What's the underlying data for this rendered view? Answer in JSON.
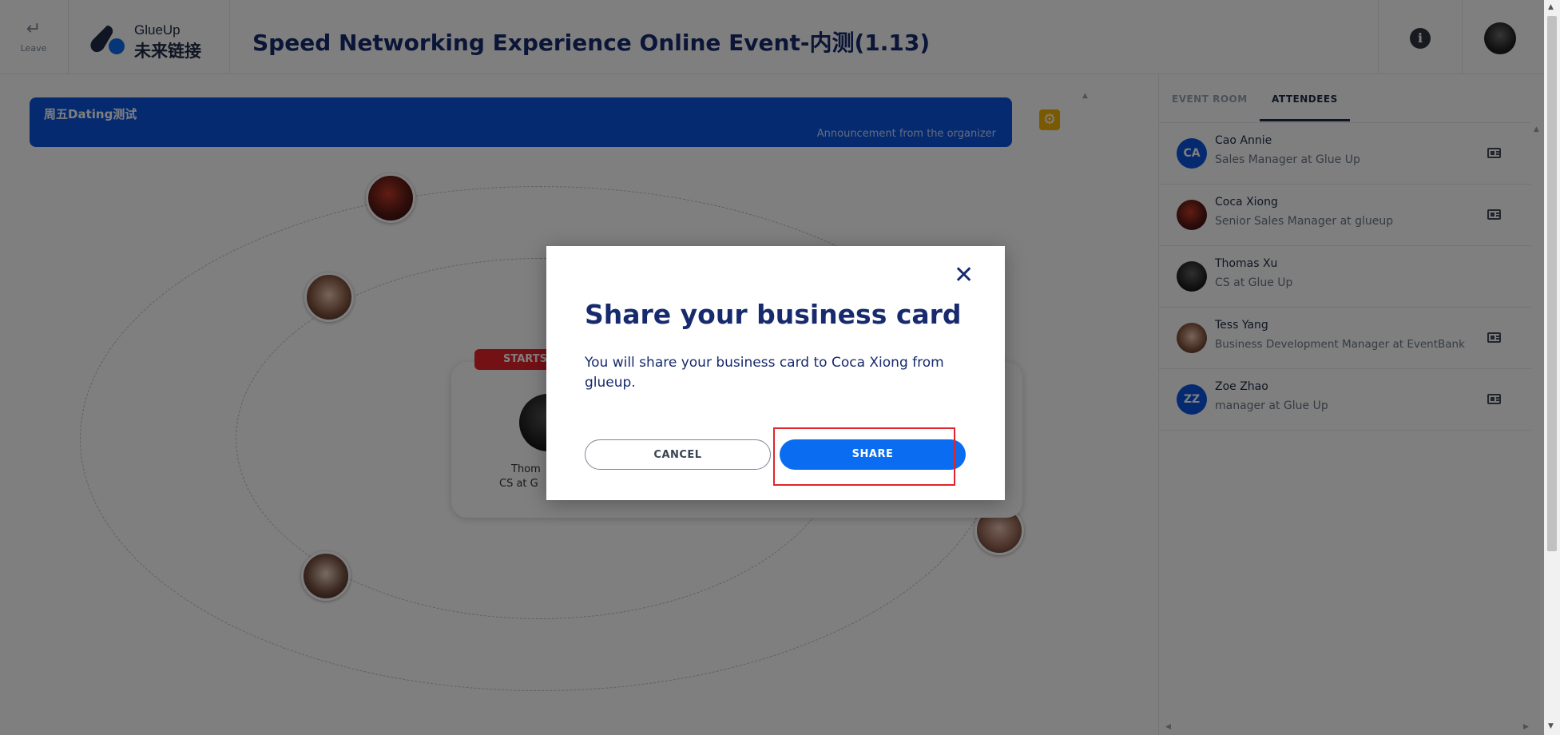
{
  "header": {
    "leave_label": "Leave",
    "brand_en": "GlueUp",
    "brand_cn": "未来链接",
    "event_title": "Speed Networking Experience Online Event-内测(1.13)",
    "info_icon": "info-icon"
  },
  "announcement": {
    "title": "周五Dating测试",
    "source": "Announcement from the organizer"
  },
  "session": {
    "badge": "STARTS",
    "partner_name": "Thom",
    "partner_role": "CS at G"
  },
  "panel": {
    "tabs": [
      {
        "label": "EVENT ROOM",
        "active": false
      },
      {
        "label": "ATTENDEES",
        "active": true
      }
    ],
    "attendees": [
      {
        "initials": "CA",
        "name": "Cao Annie",
        "role": "Sales Manager at Glue Up",
        "avatar_color": "#0a54e0",
        "has_card": true
      },
      {
        "initials": "",
        "name": "Coca Xiong",
        "role": "Senior Sales Manager at glueup",
        "avatar_color": "#8a1f1f",
        "has_card": true
      },
      {
        "initials": "",
        "name": "Thomas Xu",
        "role": "CS at Glue Up",
        "avatar_color": "#1d1d1d",
        "has_card": false
      },
      {
        "initials": "",
        "name": "Tess Yang",
        "role": "Business Development Manager at EventBank",
        "avatar_color": "#6a3a2a",
        "has_card": true
      },
      {
        "initials": "ZZ",
        "name": "Zoe Zhao",
        "role": "manager at Glue Up",
        "avatar_color": "#0a54e0",
        "has_card": true
      }
    ]
  },
  "modal": {
    "title": "Share your business card",
    "message": "You will share your business card to Coca Xiong from glueup.",
    "cancel_label": "CANCEL",
    "share_label": "SHARE"
  },
  "colors": {
    "brand_blue": "#0a54e0",
    "primary_button": "#0a6cf0",
    "title_navy": "#172a6e",
    "badge_red": "#e8232a",
    "settings_yellow": "#f5b400",
    "highlight_red": "#e0242b"
  }
}
